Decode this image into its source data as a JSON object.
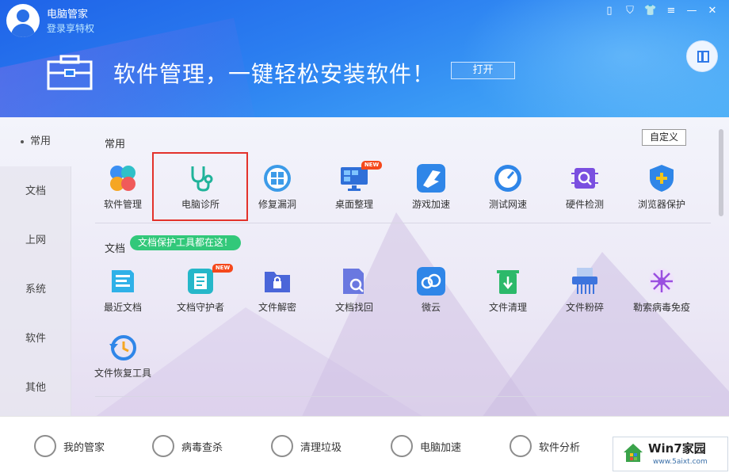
{
  "header": {
    "app_title": "电脑管家",
    "login_link": "登录享特权",
    "banner_title": "软件管理，一键轻松安装软件！",
    "open_button": "打开"
  },
  "sidebar": {
    "items": [
      {
        "label": "常用"
      },
      {
        "label": "文档"
      },
      {
        "label": "上网"
      },
      {
        "label": "系统"
      },
      {
        "label": "软件"
      },
      {
        "label": "其他"
      }
    ]
  },
  "main": {
    "customize_button": "自定义",
    "sections": [
      {
        "title": "常用",
        "tools": [
          {
            "label": "软件管理",
            "icon": "clover-apps-icon"
          },
          {
            "label": "电脑诊所",
            "icon": "stethoscope-icon"
          },
          {
            "label": "修复漏洞",
            "icon": "windows-repair-icon"
          },
          {
            "label": "桌面整理",
            "icon": "desktop-monitor-icon",
            "badge": "NEW"
          },
          {
            "label": "游戏加速",
            "icon": "game-boost-icon"
          },
          {
            "label": "测试网速",
            "icon": "speedometer-icon"
          },
          {
            "label": "硬件检测",
            "icon": "chip-icon"
          },
          {
            "label": "浏览器保护",
            "icon": "shield-icon"
          }
        ]
      },
      {
        "title": "文档",
        "tag": "文档保护工具都在这！",
        "tools": [
          {
            "label": "最近文档",
            "icon": "recent-docs-icon"
          },
          {
            "label": "文档守护者",
            "icon": "doc-guardian-icon",
            "badge": "NEW"
          },
          {
            "label": "文件解密",
            "icon": "folder-lock-icon"
          },
          {
            "label": "文档找回",
            "icon": "doc-search-icon"
          },
          {
            "label": "微云",
            "icon": "cloud-icon"
          },
          {
            "label": "文件清理",
            "icon": "trash-icon"
          },
          {
            "label": "文件粉碎",
            "icon": "shredder-icon"
          },
          {
            "label": "勒索病毒免疫",
            "icon": "virus-icon"
          }
        ]
      },
      {
        "title": "",
        "tools": [
          {
            "label": "文件恢复工具",
            "icon": "file-restore-icon"
          }
        ]
      }
    ]
  },
  "bottombar": {
    "items": [
      {
        "label": "我的管家"
      },
      {
        "label": "病毒查杀"
      },
      {
        "label": "清理垃圾"
      },
      {
        "label": "电脑加速"
      },
      {
        "label": "软件分析"
      }
    ]
  },
  "watermark": {
    "title": "Win7家园",
    "url": "www.5aixt.com"
  },
  "colors": {
    "header_blue": "#2b7ef0",
    "highlight_red": "#e3322b",
    "tag_green": "#32c87a",
    "badge_orange": "#f5481c"
  }
}
